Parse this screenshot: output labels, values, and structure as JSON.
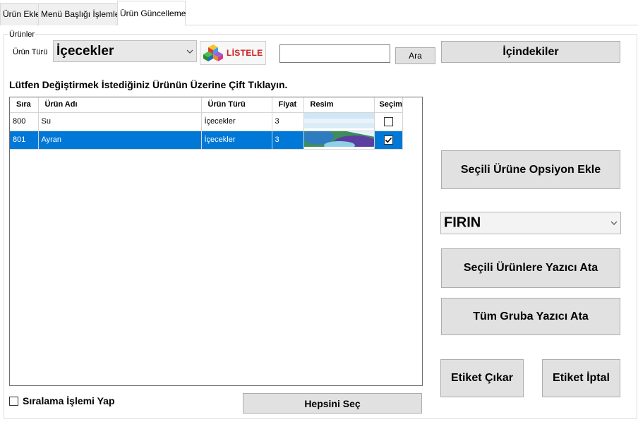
{
  "tabs": [
    {
      "label": "Ürün Ekle"
    },
    {
      "label": "Menü Başlığı İşlemleri"
    },
    {
      "label": "Ürün Güncelleme"
    }
  ],
  "group": {
    "legend": "Ürünler"
  },
  "filter": {
    "type_label": "Ürün Türü",
    "type_value": "İçecekler",
    "listele_label": "LİSTELE",
    "search_value": "",
    "search_button": "Ara",
    "contents_button": "İçindekiler"
  },
  "hint": "Lütfen Değiştirmek İstediğiniz Ürünün Üzerine Çift Tıklayın.",
  "grid": {
    "columns": [
      "Sıra",
      "Ürün Adı",
      "Ürün Türü",
      "Fiyat",
      "Resim",
      "Seçim"
    ],
    "rows": [
      {
        "sira": "800",
        "ad": "Su",
        "tur": "İçecekler",
        "fiyat": "3",
        "secim": false
      },
      {
        "sira": "801",
        "ad": "Ayran",
        "tur": "İçecekler",
        "fiyat": "3",
        "secim": true
      }
    ]
  },
  "buttons": {
    "option_add": "Seçili Ürüne Opsiyon Ekle",
    "assign_printer": "Seçili Ürünlere Yazıcı Ata",
    "group_printer": "Tüm Gruba Yazıcı Ata",
    "label_add": "Etiket Çıkar",
    "label_cancel": "Etiket İptal",
    "select_all": "Hepsini Seç"
  },
  "printer": {
    "value": "FIRIN"
  },
  "sort_checkbox": {
    "label": "Sıralama İşlemi Yap",
    "checked": false
  },
  "colors": {
    "selection": "#0078d7",
    "button_bg": "#e1e1e1",
    "listele_text": "#cc1f1f"
  }
}
